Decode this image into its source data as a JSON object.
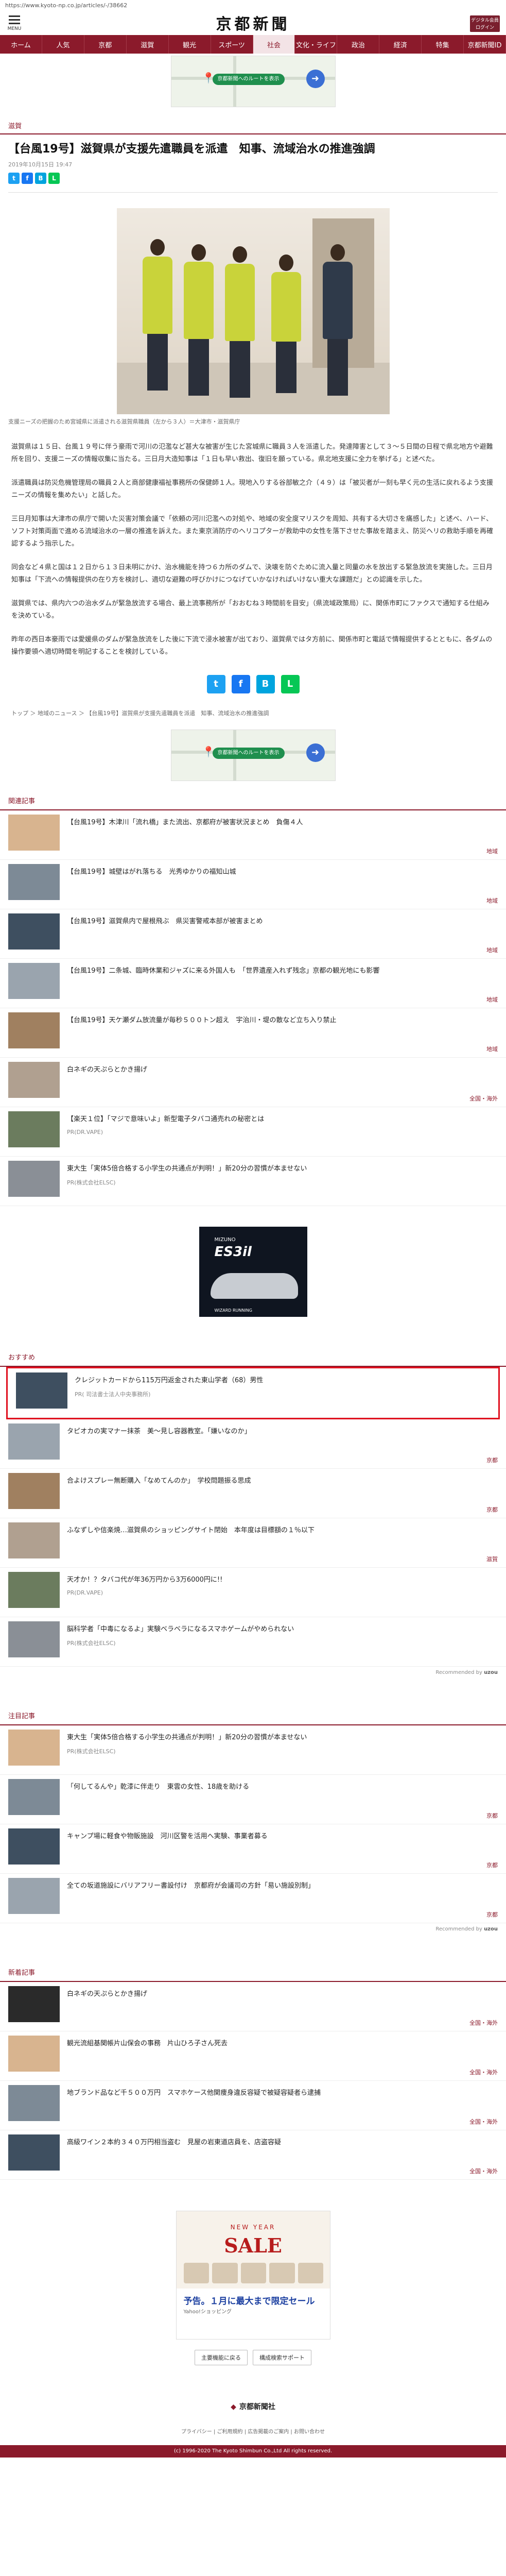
{
  "url": "https://www.kyoto-np.co.jp/articles/-/38662",
  "header": {
    "menu_label": "MENU",
    "logo": "京都新聞",
    "member_button": "デジタル会員\nログイン"
  },
  "nav": [
    "ホーム",
    "人気",
    "京都",
    "滋賀",
    "観光",
    "スポーツ",
    "社会",
    "文化・ライフ",
    "政治",
    "経済",
    "特集",
    "京都新聞ID"
  ],
  "nav_active_index": 6,
  "ad_top": {
    "label": "京都新聞へのルートを表示"
  },
  "article": {
    "section": "滋賀",
    "title": "【台風19号】滋賀県が支援先遣職員を派遣　知事、流域治水の推進強調",
    "date": "2019年10月15日 19:47",
    "photo_caption": "支援ニーズの把握のため宮城県に派遣される滋賀県職員（左から３人）＝大津市・滋賀県庁",
    "paragraphs": [
      "滋賀県は１５日、台風１９号に伴う豪雨で河川の氾濫など甚大な被害が生じた宮城県に職員３人を派遣した。発達障害として３〜５日間の日程で県北地方や避難所を回り、支援ニーズの情報収集に当たる。三日月大造知事は「１日も早い救出、復旧を願っている。県北地支援に全力を挙げる」と述べた。",
      "派遣職員は防災危機管理局の職員２人と商部健康福祉事務所の保健師１人。現地入りする谷部敏之介（４９）は「被災者が一刻も早く元の生活に戻れるよう支援ニーズの情報を集めたい」と話した。",
      "三日月知事は大津市の県庁で開いた災害対策会議で「依頼の河川氾濫への対処や、地域の安全度マリスクを周知、共有する大切さを痛感した」と述べ、ハード、ソフト対策両面で進める流域治水の一層の推進を訴えた。また東京消防庁のヘリコプターが救助中の女性を落下させた事故を踏まえ、防災ヘリの救助手順を再確認するよう指示した。",
      "同会など４県と国は１２日から１３日未明にかけ、治水機能を持つ６カ所のダムで、決壊を防ぐために流入量と同量の水を放出する緊急放流を実施した。三日月知事は「下流への情報提供の在り方を検討し、適切な避難の呼びかけにつなげていかなければいけない重大な課題だ」との認識を示した。",
      "滋賀県では、県内六つの治水ダムが緊急放流する場合、最上流事務所が「おおむね３時間前を目安」（県流域政策局）に、関係市町にファクスで通知する仕組みを決めている。",
      "昨年の西日本豪雨では愛媛県のダムが緊急放流をした後に下流で浸水被害が出ており、滋賀県ではタ方前に、関係市町と電話で情報提供するとともに、各ダムの操作要領へ適切時間を明記することを検討している。"
    ],
    "breadcrumb": "トップ ＞ 地域のニュース ＞ 【台風19号】滋賀県が支援先遣職員を派遣　知事、流域治水の推進強調"
  },
  "related": {
    "header": "関連記事",
    "items": [
      {
        "title": "【台風19号】木津川「流れ橋」また流出、京都府が被害状況まとめ　負傷４人",
        "category": "地域"
      },
      {
        "title": "【台風19号】城壁はがれ落ちる　光秀ゆかりの福知山城",
        "category": "地域"
      },
      {
        "title": "【台風19号】滋賀県内で屋根飛ぶ　県災害警戒本部が被害まとめ",
        "category": "地域"
      },
      {
        "title": "【台風19号】二条城、臨時休業和ジャズに来る外国人も　「世界遺産入れず残念」京都の観光地にも影響",
        "category": "地域"
      },
      {
        "title": "【台風19号】天ケ瀬ダム放流量が毎秒５００トン超え　宇治川・堤の散など立ち入り禁止",
        "category": "地域"
      },
      {
        "title": "白ネギの天ぷらとかき揚げ",
        "category": "全国・海外"
      },
      {
        "title": "【楽天１位】「マジで意味いよ」新型電子タバコ通売れの秘密とは",
        "category": "",
        "pr": "PR(DR.VAPE)"
      },
      {
        "title": "東大生「実体5倍合格する小学生の共通点が判明！」新20分の習慣が本ませない",
        "category": "",
        "pr": "PR(株式会社ELSC)"
      }
    ]
  },
  "mid_ad": {
    "brand": "MIZUNO",
    "model": "ES3il",
    "foot": "WIZARD RUNNING"
  },
  "recommend": {
    "header": "おすすめ",
    "items": [
      {
        "title": "クレジットカードから115万円返金された東山学者（68）男性",
        "pr": "PR( 司法書士法人中央事務所)",
        "highlight": true
      },
      {
        "title": "タピオカの実マナー抹茶　美〜見し容器教室。「嫌いなのか」",
        "category": "京都"
      },
      {
        "title": "合よけスプレー無断購入「なめてんのか」　学校問題振る思成",
        "category": "京都"
      },
      {
        "title": "ふなずしや信楽焼…滋賀県のショッピングサイト閉始　本年度は目標額の１％以下",
        "category": "滋賀"
      },
      {
        "title": "天才か！？タバコ代が年36万円から3万6000円に!!",
        "category": "",
        "pr": "PR(DR.VAPE)"
      },
      {
        "title": "脳科学者「中毒になるよ」実験ベラベラになるスマホゲームがやめられない",
        "category": "",
        "pr": "PR(株式会社ELSC)"
      }
    ],
    "recommended_by": "Recommended by",
    "recommended_brand": "uzou"
  },
  "popular": {
    "header": "注目記事",
    "items": [
      {
        "title": "東大生「実体5倍合格する小学生の共通点が判明！」新20分の習慣が本ませない",
        "pr": "PR(株式会社ELSC)"
      },
      {
        "title": "「何してるんや」乾漆に伴走り　東雲の女性、18歳を助ける",
        "category": "京都"
      },
      {
        "title": "キャンプ場に軽食や物販施設　河川区警を活用へ実験、事業者募る",
        "category": "京都"
      },
      {
        "title": "全ての坂道施設にバリアフリー書設付け　京都府が会議司の方針「易い施設別制」",
        "category": "京都"
      }
    ],
    "recommended_by": "Recommended by",
    "recommended_brand": "uzou"
  },
  "latest": {
    "header": "新着記事",
    "items": [
      {
        "title": "白ネギの天ぷらとかき揚げ",
        "category": "全国・海外"
      },
      {
        "title": "観光流組基関帳片山保会の事務　片山ひろ子さん死去",
        "category": "全国・海外"
      },
      {
        "title": "地ブランド品など千５００万円　スマホケース他関痩身違反容疑で被疑容疑者ら逮捕",
        "category": "全国・海外"
      },
      {
        "title": "高級ワイン２本約３４０万円相当盗む　見屋の岩東道店員を、店盗容疑",
        "category": "全国・海外"
      }
    ]
  },
  "bottom_ad": {
    "newyear": "NEW YEAR",
    "sale": "SALE",
    "line1": "予告。１月に最大まで限定セール",
    "line2": "Yahoo!ショッピング"
  },
  "footer": {
    "buttons": [
      "主要機能に戻る",
      "構成検索サポート"
    ],
    "logo": "京都新聞社",
    "links": "プライバシー | ご利用規約 | 広告掲載のご案内 | お問い合わせ",
    "copyright": "(c) 1996-2020 The Kyoto Shimbun Co.,Ltd All rights reserved."
  },
  "colors": {
    "brand": "#8b1a2b",
    "highlight": "#e0101e"
  }
}
